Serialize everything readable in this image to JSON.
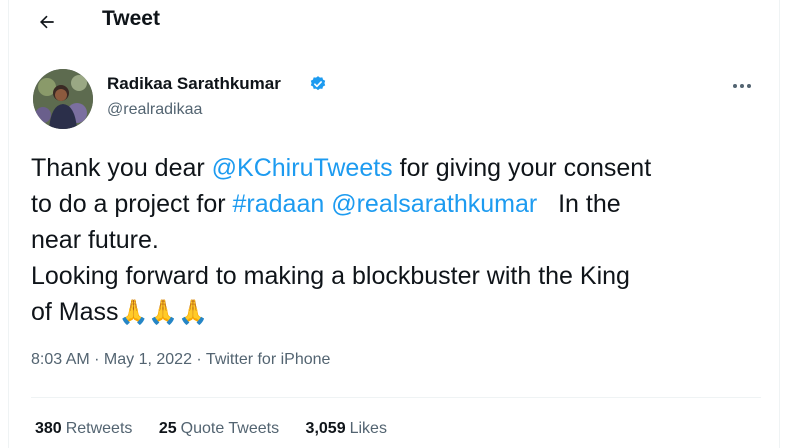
{
  "header": {
    "title": "Tweet"
  },
  "author": {
    "display_name": "Radikaa Sarathkumar",
    "handle": "@realradikaa",
    "verified_color": "#1d9bf0"
  },
  "tweet": {
    "line1_a": "Thank you dear ",
    "line1_mention": "@KChiruTweets",
    "line1_b": " for giving your consent",
    "line2_a": "to do a project for ",
    "line2_hashtag": "#radaan",
    "line2_mention": "@realsarathkumar",
    "line2_b": "   In the",
    "line3": "near future.",
    "line4": "Looking forward to making a blockbuster with the King",
    "line5": "of Mass",
    "emoji": "🙏🙏🙏"
  },
  "meta": {
    "time": "8:03 AM",
    "sep1": " · ",
    "date": "May 1, 2022",
    "sep2": " · ",
    "source": "Twitter for iPhone"
  },
  "stats": {
    "retweets_count": "380",
    "retweets_label": "Retweets",
    "quotes_count": "25",
    "quotes_label": "Quote Tweets",
    "likes_count": "3,059",
    "likes_label": "Likes"
  },
  "colors": {
    "link": "#1d9bf0",
    "text": "#0f1419",
    "secondary": "#536471"
  },
  "icons": {
    "back": "arrow-left-icon",
    "more": "more-horizontal-icon",
    "verified": "verified-badge-icon"
  }
}
